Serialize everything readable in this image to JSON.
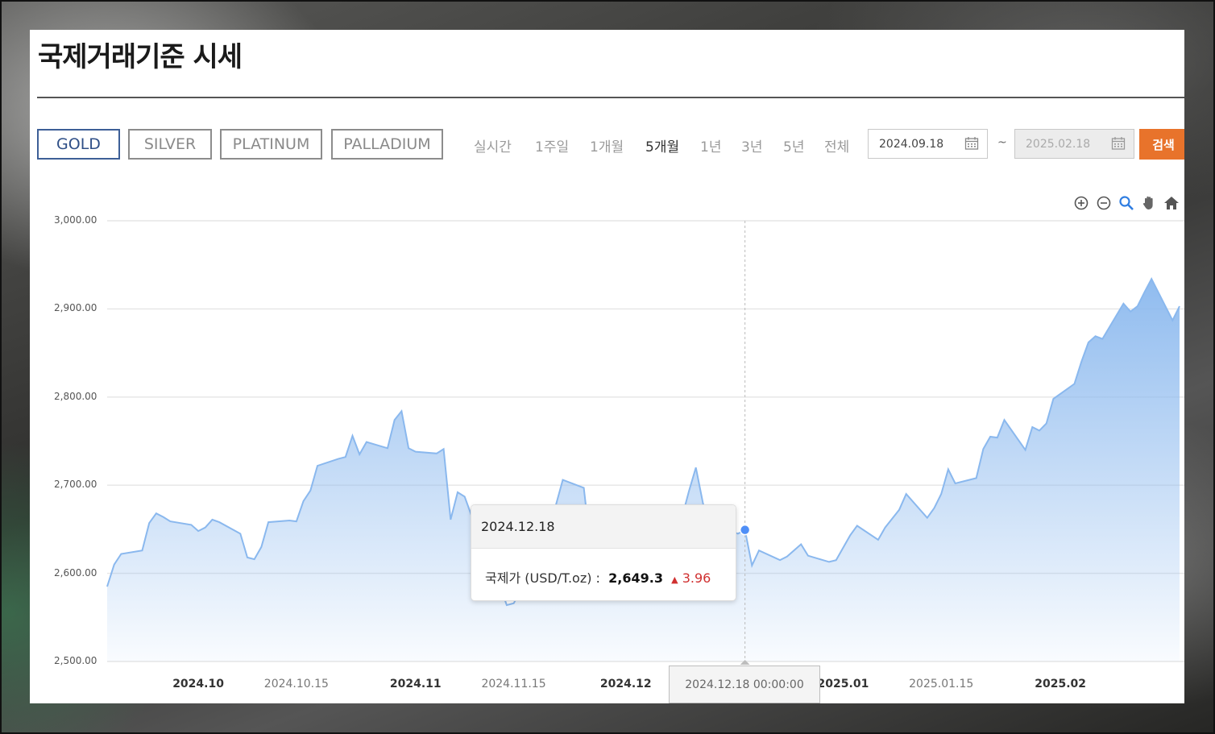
{
  "page": {
    "title": "국제거래기준 시세"
  },
  "metals": [
    {
      "label": "GOLD",
      "active": true
    },
    {
      "label": "SILVER",
      "active": false
    },
    {
      "label": "PLATINUM",
      "active": false
    },
    {
      "label": "PALLADIUM",
      "active": false
    }
  ],
  "periods": [
    {
      "label": "실시간",
      "active": false
    },
    {
      "label": "1주일",
      "active": false
    },
    {
      "label": "1개월",
      "active": false
    },
    {
      "label": "5개월",
      "active": true
    },
    {
      "label": "1년",
      "active": false
    },
    {
      "label": "3년",
      "active": false
    },
    {
      "label": "5년",
      "active": false
    },
    {
      "label": "전체",
      "active": false
    }
  ],
  "date_range": {
    "start": "2024.09.18",
    "separator": "~",
    "end": "2025.02.18",
    "search_label": "검색"
  },
  "tools": [
    "zoom-in-icon",
    "zoom-out-icon",
    "zoom-select-icon",
    "pan-hand-icon",
    "home-icon"
  ],
  "colors": {
    "accent": "#e8732b",
    "active_tab": "#3d5f97",
    "series": "#8ab8ee",
    "point": "#4f8ff7",
    "up": "#d03030"
  },
  "tooltip": {
    "date": "2024.12.18",
    "label": "국제가 (USD/T.oz)",
    "value": "2,649.3",
    "arrow": "▲",
    "change": "3.96"
  },
  "crosshair_label": "2024.12.18 00:00:00",
  "chart_data": {
    "type": "area",
    "title": "",
    "xlabel": "",
    "ylabel": "",
    "ylim": [
      2500,
      3000
    ],
    "y_ticks": [
      "3,000.00",
      "2,900.00",
      "2,800.00",
      "2,700.00",
      "2,600.00",
      "2,500.00"
    ],
    "x_ticks": [
      {
        "date": "2024-10-01",
        "label": "2024.10",
        "major": true
      },
      {
        "date": "2024-10-15",
        "label": "2024.10.15",
        "major": false
      },
      {
        "date": "2024-11-01",
        "label": "2024.11",
        "major": true
      },
      {
        "date": "2024-11-15",
        "label": "2024.11.15",
        "major": false
      },
      {
        "date": "2024-12-01",
        "label": "2024.12",
        "major": true
      },
      {
        "date": "2025-01-01",
        "label": "2025.01",
        "major": true
      },
      {
        "date": "2025-01-15",
        "label": "2025.01.15",
        "major": false
      },
      {
        "date": "2025-02-01",
        "label": "2025.02",
        "major": true
      }
    ],
    "grid": true,
    "highlight": {
      "date": "2024-12-18",
      "value": 2649.3
    },
    "series": [
      {
        "x": [
          "2024-09-18",
          "2024-09-19",
          "2024-09-20",
          "2024-09-23",
          "2024-09-24",
          "2024-09-25",
          "2024-09-26",
          "2024-09-27",
          "2024-09-30",
          "2024-10-01",
          "2024-10-02",
          "2024-10-03",
          "2024-10-04",
          "2024-10-07",
          "2024-10-08",
          "2024-10-09",
          "2024-10-10",
          "2024-10-11",
          "2024-10-14",
          "2024-10-15",
          "2024-10-16",
          "2024-10-17",
          "2024-10-18",
          "2024-10-21",
          "2024-10-22",
          "2024-10-23",
          "2024-10-24",
          "2024-10-25",
          "2024-10-28",
          "2024-10-29",
          "2024-10-30",
          "2024-10-31",
          "2024-11-01",
          "2024-11-04",
          "2024-11-05",
          "2024-11-06",
          "2024-11-07",
          "2024-11-08",
          "2024-11-11",
          "2024-11-12",
          "2024-11-13",
          "2024-11-14",
          "2024-11-15",
          "2024-11-18",
          "2024-11-19",
          "2024-11-20",
          "2024-11-21",
          "2024-11-22",
          "2024-11-25",
          "2024-11-26",
          "2024-11-27",
          "2024-11-28",
          "2024-11-29",
          "2024-12-02",
          "2024-12-03",
          "2024-12-04",
          "2024-12-05",
          "2024-12-06",
          "2024-12-09",
          "2024-12-10",
          "2024-12-11",
          "2024-12-12",
          "2024-12-13",
          "2024-12-16",
          "2024-12-17",
          "2024-12-18",
          "2024-12-19",
          "2024-12-20",
          "2024-12-23",
          "2024-12-24",
          "2024-12-26",
          "2024-12-27",
          "2024-12-30",
          "2024-12-31",
          "2025-01-02",
          "2025-01-03",
          "2025-01-06",
          "2025-01-07",
          "2025-01-08",
          "2025-01-09",
          "2025-01-10",
          "2025-01-13",
          "2025-01-14",
          "2025-01-15",
          "2025-01-16",
          "2025-01-17",
          "2025-01-20",
          "2025-01-21",
          "2025-01-22",
          "2025-01-23",
          "2025-01-24",
          "2025-01-27",
          "2025-01-28",
          "2025-01-29",
          "2025-01-30",
          "2025-01-31",
          "2025-02-03",
          "2025-02-04",
          "2025-02-05",
          "2025-02-06",
          "2025-02-07",
          "2025-02-10",
          "2025-02-11",
          "2025-02-12",
          "2025-02-13",
          "2025-02-14",
          "2025-02-17",
          "2025-02-18"
        ],
        "values": [
          2585,
          2610,
          2622,
          2626,
          2657,
          2668,
          2664,
          2659,
          2655,
          2648,
          2652,
          2661,
          2658,
          2645,
          2618,
          2616,
          2630,
          2658,
          2660,
          2659,
          2682,
          2694,
          2722,
          2730,
          2732,
          2756,
          2735,
          2749,
          2742,
          2774,
          2784,
          2742,
          2738,
          2736,
          2741,
          2661,
          2692,
          2687,
          2621,
          2599,
          2587,
          2564,
          2566,
          2611,
          2637,
          2651,
          2677,
          2706,
          2697,
          2627,
          2638,
          2643,
          2643,
          2641,
          2643,
          2649,
          2631,
          2632,
          2663,
          2693,
          2720,
          2680,
          2648,
          2648,
          2645,
          2649.3,
          2609,
          2626,
          2615,
          2619,
          2633,
          2620,
          2613,
          2615,
          2643,
          2654,
          2638,
          2652,
          2662,
          2672,
          2690,
          2663,
          2674,
          2690,
          2718,
          2702,
          2708,
          2741,
          2755,
          2754,
          2774,
          2740,
          2766,
          2762,
          2770,
          2798,
          2815,
          2840,
          2862,
          2869,
          2866,
          2906,
          2897,
          2903,
          2919,
          2934,
          2887,
          2903
        ]
      }
    ]
  }
}
